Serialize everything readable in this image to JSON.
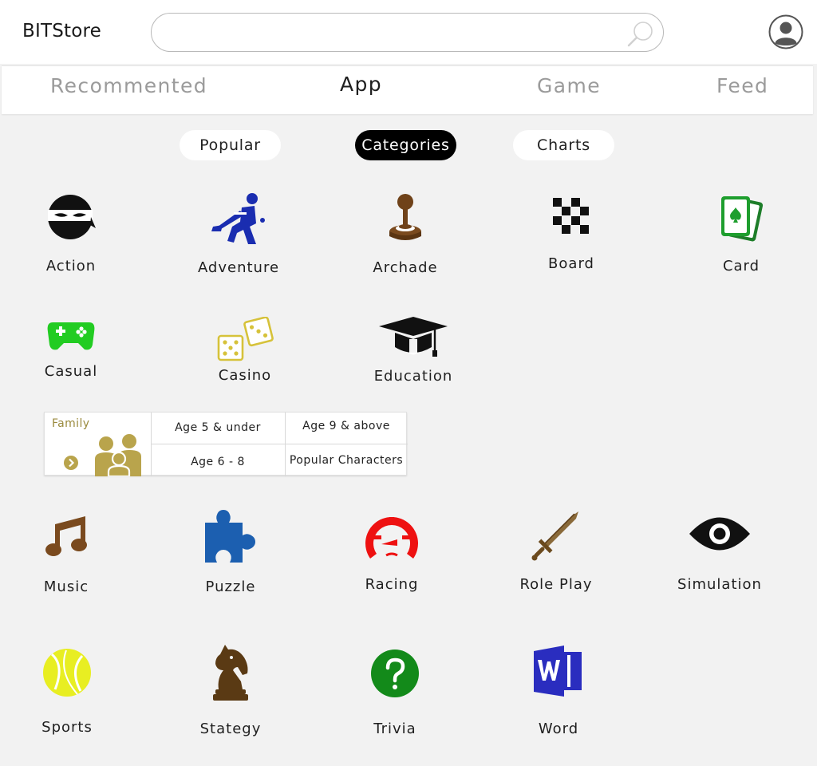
{
  "header": {
    "logo_bold": "BIT",
    "logo_rest": "Store",
    "search_placeholder": "",
    "search_value": ""
  },
  "tabs": [
    {
      "label": "Recommented",
      "active": false
    },
    {
      "label": "App",
      "active": true
    },
    {
      "label": "Game",
      "active": false
    },
    {
      "label": "Feed",
      "active": false
    }
  ],
  "pills": [
    {
      "label": "Popular",
      "active": false
    },
    {
      "label": "Categories",
      "active": true
    },
    {
      "label": "Charts",
      "active": false
    }
  ],
  "categories": [
    {
      "label": "Action",
      "icon": "ninja-icon",
      "color": "#111111"
    },
    {
      "label": "Adventure",
      "icon": "hockey-player-icon",
      "color": "#1a2db0"
    },
    {
      "label": "Archade",
      "icon": "joystick-icon",
      "color": "#7a4a1e"
    },
    {
      "label": "Board",
      "icon": "checkerboard-icon",
      "color": "#111111"
    },
    {
      "label": "Card",
      "icon": "playing-cards-icon",
      "color": "#1e9e2e"
    },
    {
      "label": "Casual",
      "icon": "gamepad-icon",
      "color": "#22cc22"
    },
    {
      "label": "Casino",
      "icon": "dice-icon",
      "color": "#d6c23a"
    },
    {
      "label": "Education",
      "icon": "graduation-cap-icon",
      "color": "#111111"
    },
    {
      "label": "Music",
      "icon": "music-note-icon",
      "color": "#7a4a1e"
    },
    {
      "label": "Puzzle",
      "icon": "puzzle-piece-icon",
      "color": "#1c5fb0"
    },
    {
      "label": "Racing",
      "icon": "speedometer-icon",
      "color": "#ee1111"
    },
    {
      "label": "Role Play",
      "icon": "sword-icon",
      "color": "#6b4a1e"
    },
    {
      "label": "Simulation",
      "icon": "eye-icon",
      "color": "#111111"
    },
    {
      "label": "Sports",
      "icon": "tennis-ball-icon",
      "color": "#e8ee22"
    },
    {
      "label": "Stategy",
      "icon": "chess-knight-icon",
      "color": "#5a3a14"
    },
    {
      "label": "Trivia",
      "icon": "question-mark-icon",
      "color": "#138a1a"
    },
    {
      "label": "Word",
      "icon": "word-document-icon",
      "color": "#2a2dbf"
    }
  ],
  "family": {
    "title": "Family",
    "links": [
      "Age 5 & under",
      "Age 9 & above",
      "Age 6 - 8",
      "Popular Characters"
    ],
    "accent": "#b9a44c"
  }
}
